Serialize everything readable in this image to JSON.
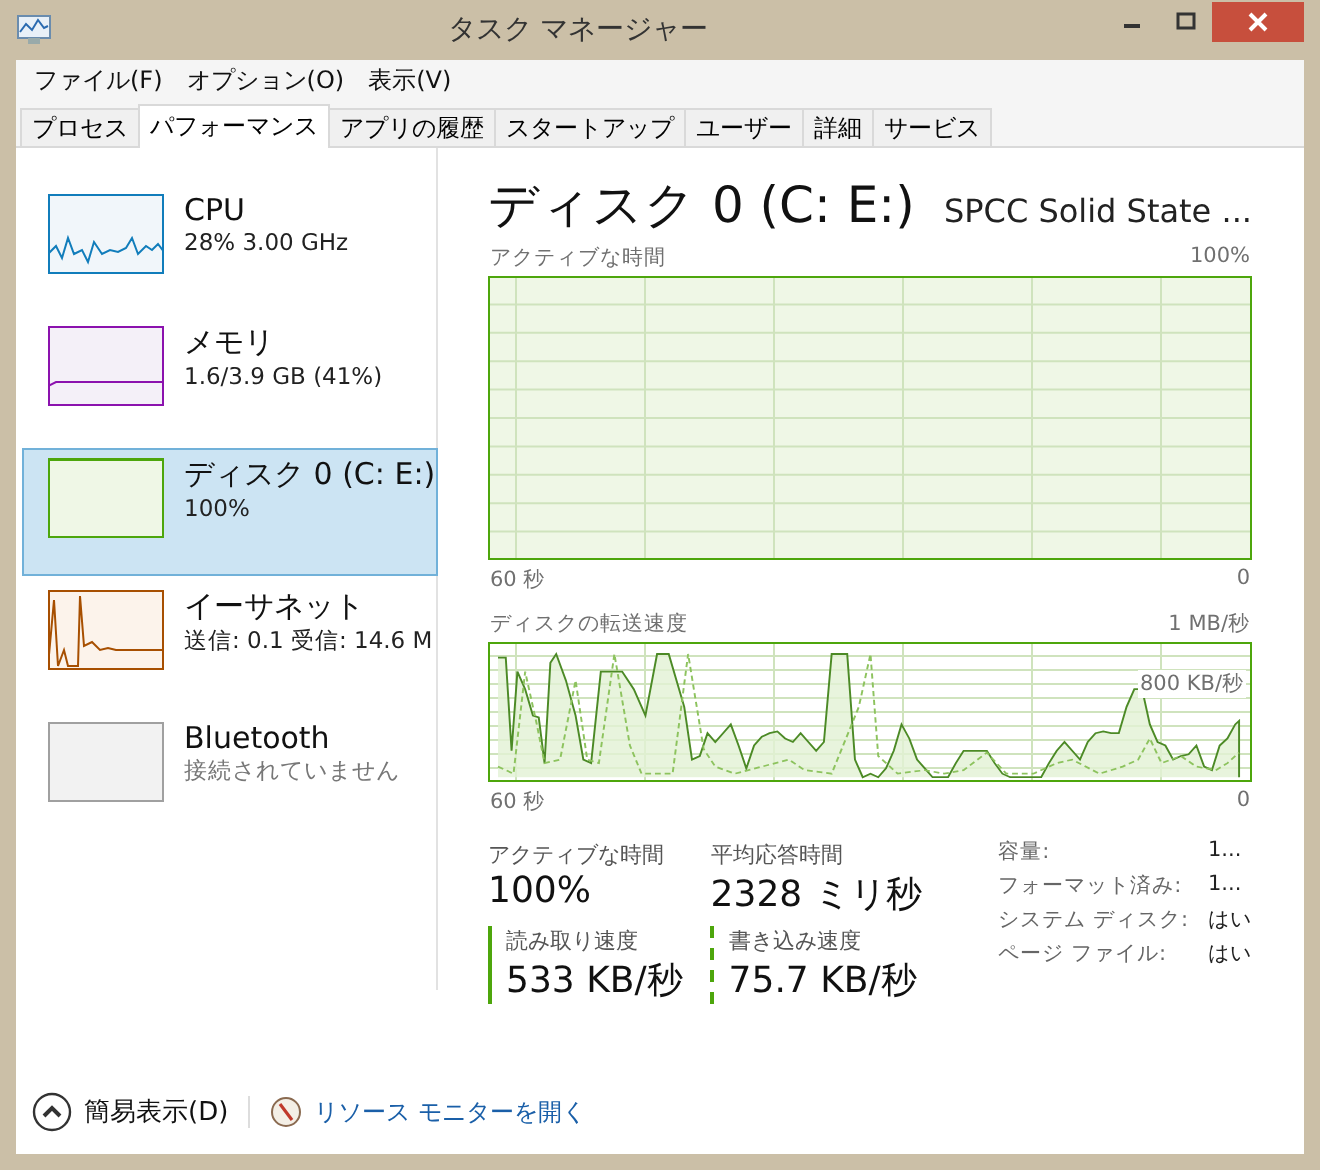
{
  "window": {
    "title": "タスク マネージャー"
  },
  "menu": [
    "ファイル(F)",
    "オプション(O)",
    "表示(V)"
  ],
  "tabs": [
    {
      "label": "プロセス",
      "selected": false
    },
    {
      "label": "パフォーマンス",
      "selected": true
    },
    {
      "label": "アプリの履歴",
      "selected": false
    },
    {
      "label": "スタートアップ",
      "selected": false
    },
    {
      "label": "ユーザー",
      "selected": false
    },
    {
      "label": "詳細",
      "selected": false
    },
    {
      "label": "サービス",
      "selected": false
    }
  ],
  "sidebar": {
    "items": [
      {
        "kind": "cpu",
        "name": "CPU",
        "detail": "28% 3.00 GHz",
        "color": "#117dbb",
        "selected": false
      },
      {
        "kind": "memory",
        "name": "メモリ",
        "detail": "1.6/3.9 GB (41%)",
        "color": "#8b12ae",
        "selected": false
      },
      {
        "kind": "disk",
        "name": "ディスク 0 (C: E:)",
        "detail": "100%",
        "color": "#4da60c",
        "selected": true
      },
      {
        "kind": "ethernet",
        "name": "イーサネット",
        "detail": "送信: 0.1 受信: 14.6 M",
        "color": "#a74f01",
        "selected": false
      },
      {
        "kind": "bluetooth",
        "name": "Bluetooth",
        "detail": "接続されていません",
        "color": "#a0a0a0",
        "selected": false
      }
    ]
  },
  "detail": {
    "title": "ディスク 0 (C: E:)",
    "model": "SPCC Solid State ...",
    "active_chart": {
      "label": "アクティブな時間",
      "max": "100%",
      "x_start": "60 秒",
      "x_end": "0"
    },
    "transfer_chart": {
      "label": "ディスクの転送速度",
      "max": "1 MB/秒",
      "marker": "800 KB/秒",
      "x_start": "60 秒",
      "x_end": "0"
    },
    "stats": [
      {
        "label": "アクティブな時間",
        "value": "100%"
      },
      {
        "label": "平均応答時間",
        "value": "2328 ミリ秒"
      }
    ],
    "rates": [
      {
        "kind": "solid",
        "label": "読み取り速度",
        "value": "533 KB/秒"
      },
      {
        "kind": "dashed",
        "label": "書き込み速度",
        "value": "75.7 KB/秒"
      }
    ],
    "properties": [
      {
        "label": "容量:",
        "value": "1..."
      },
      {
        "label": "フォーマット済み:",
        "value": "1..."
      },
      {
        "label": "システム ディスク:",
        "value": "はい"
      },
      {
        "label": "ページ ファイル:",
        "value": "はい"
      }
    ]
  },
  "footer": {
    "fewer_details": "簡易表示(D)",
    "resource_monitor": "リソース モニターを開く"
  }
}
